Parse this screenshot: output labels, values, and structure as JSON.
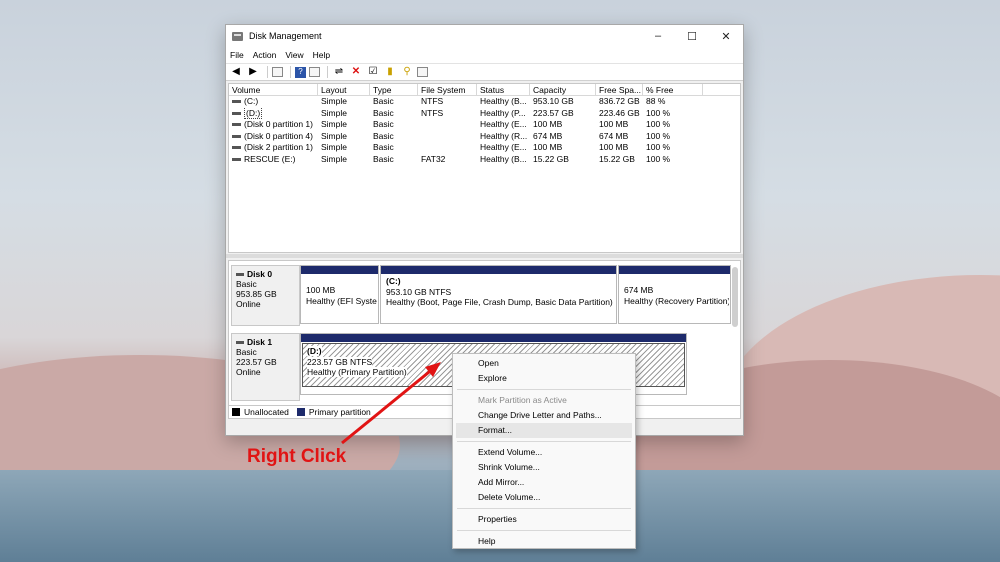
{
  "window": {
    "title": "Disk Management",
    "controls": {
      "minimize": "–",
      "maximize": "☐",
      "close": "✕"
    }
  },
  "menu": [
    "File",
    "Action",
    "View",
    "Help"
  ],
  "toolbar_icons": [
    "back-icon",
    "forward-icon",
    "properties-icon",
    "help-icon",
    "view-icon",
    "connect-icon",
    "delete-icon",
    "check-icon",
    "new-icon",
    "search-icon",
    "list-icon"
  ],
  "volume_list": {
    "columns": [
      "Volume",
      "Layout",
      "Type",
      "File System",
      "Status",
      "Capacity",
      "Free Spa...",
      "% Free"
    ],
    "rows": [
      [
        "(C:)",
        "Simple",
        "Basic",
        "NTFS",
        "Healthy (B...",
        "953.10 GB",
        "836.72 GB",
        "88 %"
      ],
      [
        "(D:)",
        "Simple",
        "Basic",
        "NTFS",
        "Healthy (P...",
        "223.57 GB",
        "223.46 GB",
        "100 %"
      ],
      [
        "(Disk 0 partition 1)",
        "Simple",
        "Basic",
        "",
        "Healthy (E...",
        "100 MB",
        "100 MB",
        "100 %"
      ],
      [
        "(Disk 0 partition 4)",
        "Simple",
        "Basic",
        "",
        "Healthy (R...",
        "674 MB",
        "674 MB",
        "100 %"
      ],
      [
        "(Disk 2 partition 1)",
        "Simple",
        "Basic",
        "",
        "Healthy (E...",
        "100 MB",
        "100 MB",
        "100 %"
      ],
      [
        "RESCUE (E:)",
        "Simple",
        "Basic",
        "FAT32",
        "Healthy (B...",
        "15.22 GB",
        "15.22 GB",
        "100 %"
      ]
    ]
  },
  "disks": [
    {
      "name": "Disk 0",
      "type": "Basic",
      "size": "953.85 GB",
      "state": "Online",
      "partitions": [
        {
          "title": "",
          "size": "100 MB",
          "status": "Healthy (EFI Systen"
        },
        {
          "title": "(C:)",
          "size": "953.10 GB NTFS",
          "status": "Healthy (Boot, Page File, Crash Dump, Basic Data Partition)"
        },
        {
          "title": "",
          "size": "674 MB",
          "status": "Healthy (Recovery Partition)"
        }
      ]
    },
    {
      "name": "Disk 1",
      "type": "Basic",
      "size": "223.57 GB",
      "state": "Online",
      "partitions": [
        {
          "title": "(D:)",
          "size": "223.57 GB NTFS",
          "status": "Healthy (Primary Partition)"
        }
      ]
    }
  ],
  "legend": {
    "unallocated": "Unallocated",
    "primary": "Primary partition",
    "unallocated_color": "#000000",
    "primary_color": "#1d2a6b"
  },
  "context_menu": {
    "open": "Open",
    "explore": "Explore",
    "mark_active": "Mark Partition as Active",
    "change_letter": "Change Drive Letter and Paths...",
    "format": "Format...",
    "extend": "Extend Volume...",
    "shrink": "Shrink Volume...",
    "add_mirror": "Add Mirror...",
    "delete": "Delete Volume...",
    "properties": "Properties",
    "help": "Help"
  },
  "annotation": {
    "text": "Right Click",
    "color": "#e11414"
  }
}
